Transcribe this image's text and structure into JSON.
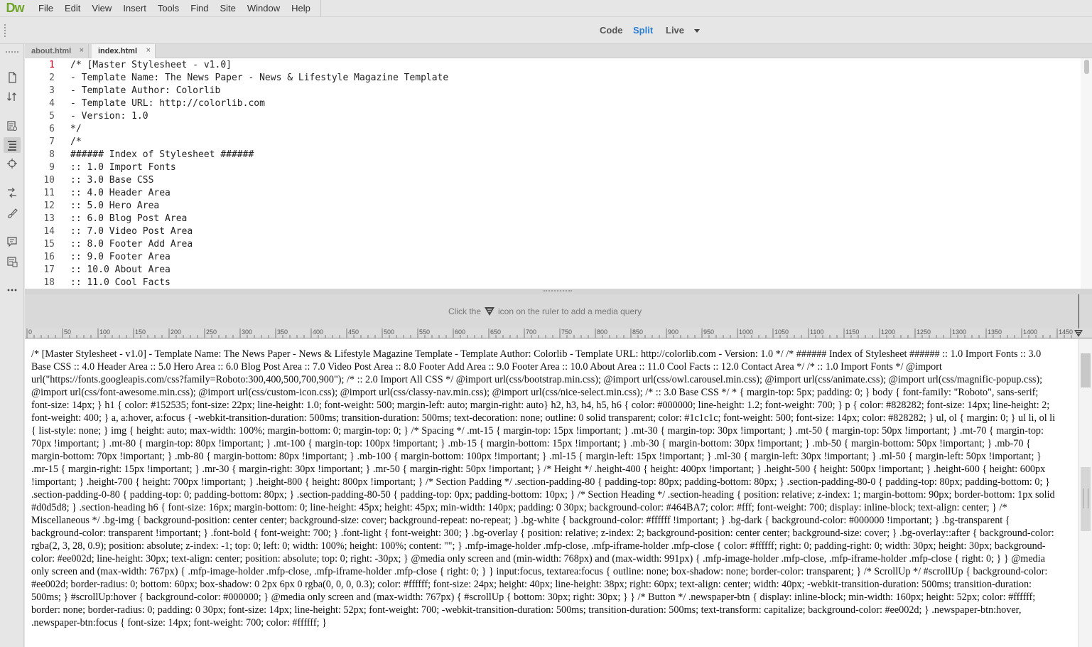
{
  "app": {
    "logo": "Dw"
  },
  "menu": [
    "File",
    "Edit",
    "View",
    "Insert",
    "Tools",
    "Find",
    "Site",
    "Window",
    "Help"
  ],
  "view_switcher": {
    "code": "Code",
    "split": "Split",
    "live": "Live",
    "active": "Split"
  },
  "tabs": [
    {
      "label": "about.html",
      "close": "×",
      "active": false
    },
    {
      "label": "index.html",
      "close": "×",
      "active": true
    }
  ],
  "left_toolbar_icons": [
    "files-icon",
    "sort-icon",
    "properties-icon",
    "dom-icon",
    "target-icon",
    "transform-icon",
    "brush-icon",
    "comment-icon",
    "snippets-icon",
    "more-icon"
  ],
  "code": {
    "current_line": 1,
    "lines": [
      {
        "n": "1",
        "t": "/* [Master Stylesheet - v1.0]"
      },
      {
        "n": "2",
        "t": "- Template Name: The News Paper - News & Lifestyle Magazine Template"
      },
      {
        "n": "3",
        "t": "- Template Author: Colorlib"
      },
      {
        "n": "4",
        "t": "- Template URL: http://colorlib.com"
      },
      {
        "n": "5",
        "t": "- Version: 1.0"
      },
      {
        "n": "6",
        "t": "*/"
      },
      {
        "n": "7",
        "t": "/*"
      },
      {
        "n": "8",
        "t": "###### Index of Stylesheet ######"
      },
      {
        "n": "9",
        "t": ":: 1.0 Import Fonts"
      },
      {
        "n": "10",
        "t": ":: 3.0 Base CSS"
      },
      {
        "n": "11",
        "t": ":: 4.0 Header Area"
      },
      {
        "n": "12",
        "t": ":: 5.0 Hero Area"
      },
      {
        "n": "13",
        "t": ":: 6.0 Blog Post Area"
      },
      {
        "n": "14",
        "t": ":: 7.0 Video Post Area"
      },
      {
        "n": "15",
        "t": ":: 8.0 Footer Add Area"
      },
      {
        "n": "16",
        "t": ":: 9.0 Footer Area"
      },
      {
        "n": "17",
        "t": ":: 10.0 About Area"
      },
      {
        "n": "18",
        "t": ":: 11.0 Cool Facts"
      }
    ]
  },
  "media_query_bar": {
    "before": "Click the",
    "after": "icon on the ruler to add a media query"
  },
  "ruler": {
    "labels": [
      "0",
      "50",
      "100",
      "150",
      "200",
      "250",
      "300",
      "350",
      "400",
      "450",
      "500",
      "550",
      "600",
      "650",
      "700",
      "750",
      "800",
      "850",
      "900",
      "950",
      "1000",
      "1050",
      "1100",
      "1150",
      "1200",
      "1250",
      "1300",
      "1350",
      "1400",
      "1450"
    ]
  },
  "live_view": {
    "text": "/* [Master Stylesheet - v1.0] - Template Name: The News Paper - News & Lifestyle Magazine Template - Template Author: Colorlib - Template URL: http://colorlib.com - Version: 1.0 */ /* ###### Index of Stylesheet ###### :: 1.0 Import Fonts :: 3.0 Base CSS :: 4.0 Header Area :: 5.0 Hero Area :: 6.0 Blog Post Area :: 7.0 Video Post Area :: 8.0 Footer Add Area :: 9.0 Footer Area :: 10.0 About Area :: 11.0 Cool Facts :: 12.0 Contact Area */ /* :: 1.0 Import Fonts */ @import url(\"https://fonts.googleapis.com/css?family=Roboto:300,400,500,700,900\"); /* :: 2.0 Import All CSS */ @import url(css/bootstrap.min.css); @import url(css/owl.carousel.min.css); @import url(css/animate.css); @import url(css/magnific-popup.css); @import url(css/font-awesome.min.css); @import url(css/custom-icon.css); @import url(css/classy-nav.min.css); @import url(css/nice-select.min.css); /* :: 3.0 Base CSS */ * { margin-top: 5px; padding: 0; } body { font-family: \"Roboto\", sans-serif; font-size: 14px; } h1 { color: #152535; font-size: 22px; line-height: 1.0; font-weight: 500; margin-left: auto; margin-right: auto} h2, h3, h4, h5, h6 { color: #000000; line-height: 1.2; font-weight: 700; } p { color: #828282; font-size: 14px; line-height: 2; font-weight: 400; } a, a:hover, a:focus { -webkit-transition-duration: 500ms; transition-duration: 500ms; text-decoration: none; outline: 0 solid transparent; color: #1c1c1c; font-weight: 500; font-size: 14px; color: #828282; } ul, ol { margin: 0; } ul li, ol li { list-style: none; } img { height: auto; max-width: 100%; margin-bottom: 0; margin-top: 0; } /* Spacing */ .mt-15 { margin-top: 15px !important; } .mt-30 { margin-top: 30px !important; } .mt-50 { margin-top: 50px !important; } .mt-70 { margin-top: 70px !important; } .mt-80 { margin-top: 80px !important; } .mt-100 { margin-top: 100px !important; } .mb-15 { margin-bottom: 15px !important; } .mb-30 { margin-bottom: 30px !important; } .mb-50 { margin-bottom: 50px !important; } .mb-70 { margin-bottom: 70px !important; } .mb-80 { margin-bottom: 80px !important; } .mb-100 { margin-bottom: 100px !important; } .ml-15 { margin-left: 15px !important; } .ml-30 { margin-left: 30px !important; } .ml-50 { margin-left: 50px !important; } .mr-15 { margin-right: 15px !important; } .mr-30 { margin-right: 30px !important; } .mr-50 { margin-right: 50px !important; } /* Height */ .height-400 { height: 400px !important; } .height-500 { height: 500px !important; } .height-600 { height: 600px !important; } .height-700 { height: 700px !important; } .height-800 { height: 800px !important; } /* Section Padding */ .section-padding-80 { padding-top: 80px; padding-bottom: 80px; } .section-padding-80-0 { padding-top: 80px; padding-bottom: 0; } .section-padding-0-80 { padding-top: 0; padding-bottom: 80px; } .section-padding-80-50 { padding-top: 0px; padding-bottom: 10px; } /* Section Heading */ .section-heading { position: relative; z-index: 1; margin-bottom: 90px; border-bottom: 1px solid #d0d5d8; } .section-heading h6 { font-size: 16px; margin-bottom: 0; line-height: 45px; height: 45px; min-width: 140px; padding: 0 30px; background-color: #464BA7; color: #fff; font-weight: 700; display: inline-block; text-align: center; } /* Miscellaneous */ .bg-img { background-position: center center; background-size: cover; background-repeat: no-repeat; } .bg-white { background-color: #ffffff !important; } .bg-dark { background-color: #000000 !important; } .bg-transparent { background-color: transparent !important; } .font-bold { font-weight: 700; } .font-light { font-weight: 300; } .bg-overlay { position: relative; z-index: 2; background-position: center center; background-size: cover; } .bg-overlay::after { background-color: rgba(2, 3, 28, 0.9); position: absolute; z-index: -1; top: 0; left: 0; width: 100%; height: 100%; content: \"\"; } .mfp-image-holder .mfp-close, .mfp-iframe-holder .mfp-close { color: #ffffff; right: 0; padding-right: 0; width: 30px; height: 30px; background-color: #ee002d; line-height: 30px; text-align: center; position: absolute; top: 0; right: -30px; } @media only screen and (min-width: 768px) and (max-width: 991px) { .mfp-image-holder .mfp-close, .mfp-iframe-holder .mfp-close { right: 0; } } @media only screen and (max-width: 767px) { .mfp-image-holder .mfp-close, .mfp-iframe-holder .mfp-close { right: 0; } } input:focus, textarea:focus { outline: none; box-shadow: none; border-color: transparent; } /* ScrollUp */ #scrollUp { background-color: #ee002d; border-radius: 0; bottom: 60px; box-shadow: 0 2px 6px 0 rgba(0, 0, 0, 0.3); color: #ffffff; font-size: 24px; height: 40px; line-height: 38px; right: 60px; text-align: center; width: 40px; -webkit-transition-duration: 500ms; transition-duration: 500ms; } #scrollUp:hover { background-color: #000000; } @media only screen and (max-width: 767px) { #scrollUp { bottom: 30px; right: 30px; } } /* Button */ .newspaper-btn { display: inline-block; min-width: 160px; height: 52px; color: #ffffff; border: none; border-radius: 0; padding: 0 30px; font-size: 14px; line-height: 52px; font-weight: 700; -webkit-transition-duration: 500ms; transition-duration: 500ms; text-transform: capitalize; background-color: #ee002d; } .newspaper-btn:hover, .newspaper-btn:focus { font-size: 14px; font-weight: 700; color: #ffffff; }"
  },
  "colors": {
    "accent": "#2a7fd4",
    "logo": "#71a42b",
    "current_line_number": "#d0021b"
  }
}
